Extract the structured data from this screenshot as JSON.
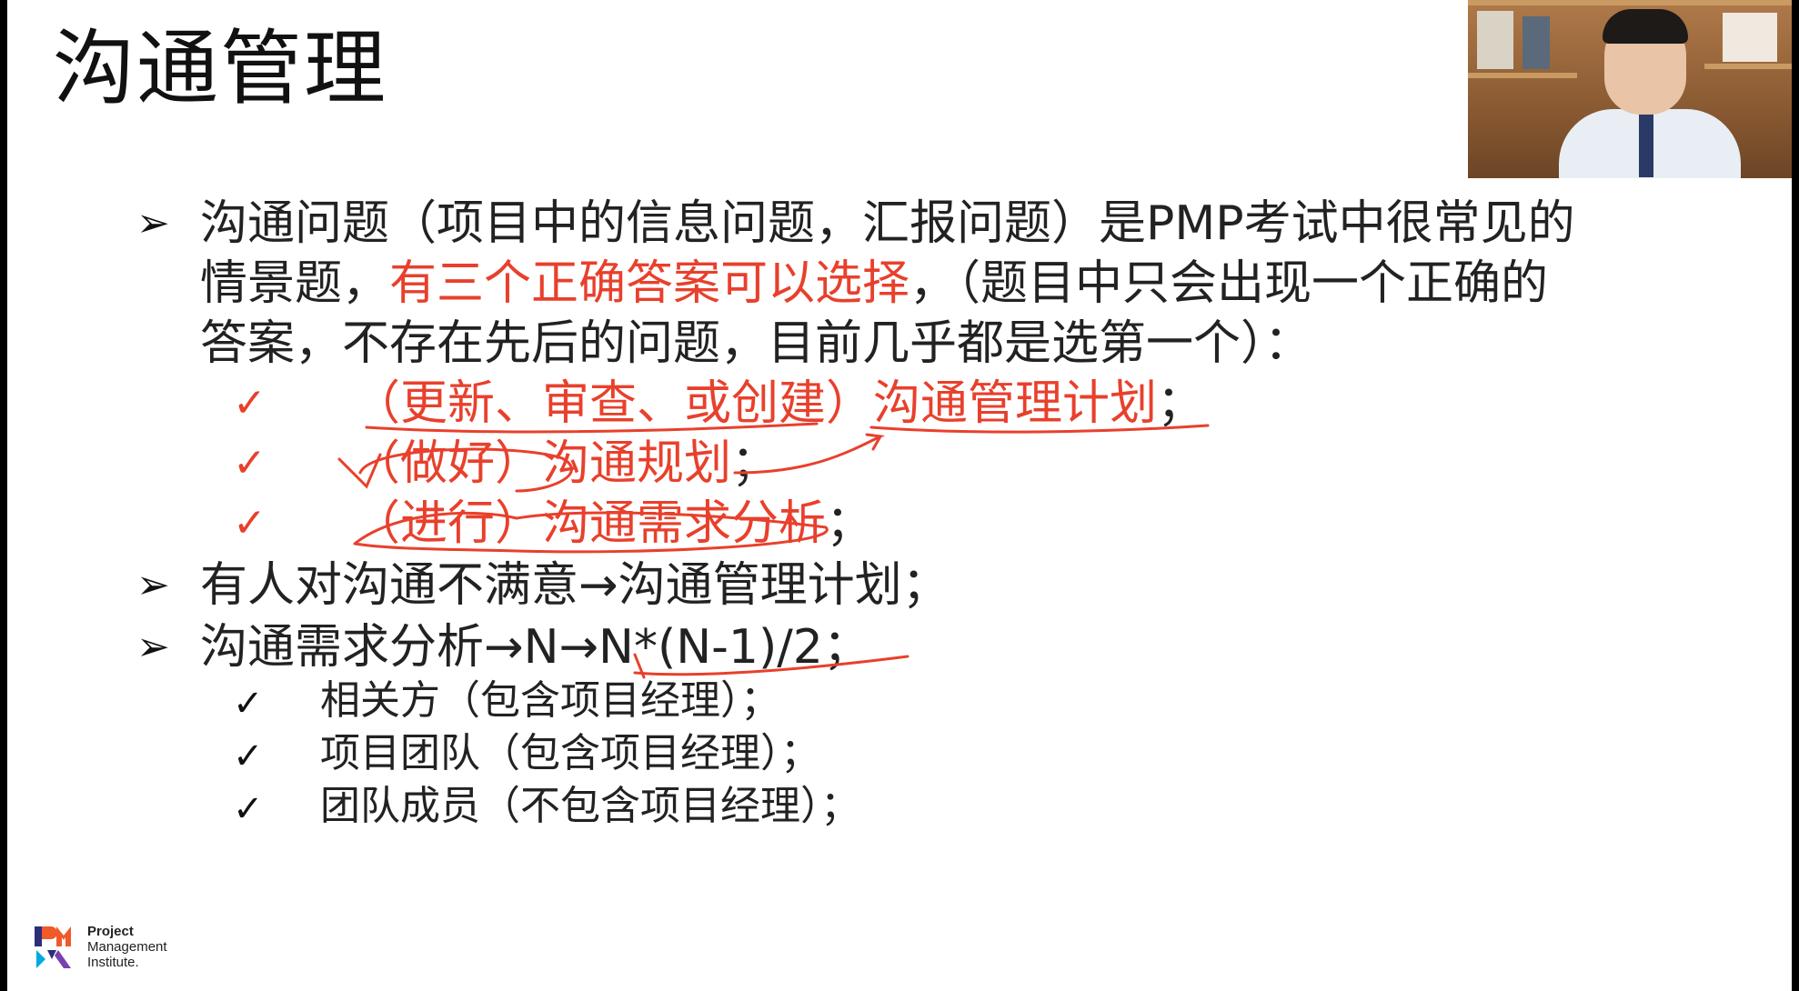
{
  "slide": {
    "title": "沟通管理",
    "bullets": [
      {
        "line1": "沟通问题（项目中的信息问题，汇报问题）是PMP考试中很常见的",
        "line2_a": "情景题，",
        "line2_red": "有三个正确答案可以选择",
        "line2_b": "，（题目中只会出现一个正确的",
        "line3": "答案，不存在先后的问题，目前几乎都是选第一个）："
      }
    ],
    "red_items": [
      {
        "check": "✓",
        "red": "（更新、审查、或创建）沟通管理计划",
        "tail": "；"
      },
      {
        "check": "✓",
        "red": "（做好）沟通规划",
        "tail": "；"
      },
      {
        "check": "✓",
        "red": "（进行）沟通需求分析",
        "tail": "；"
      }
    ],
    "bullet2": "有人对沟通不满意→沟通管理计划；",
    "bullet3": "沟通需求分析→N→N*(N-1)/2；",
    "sub_items": [
      {
        "check": "✓",
        "text": "相关方（包含项目经理）；"
      },
      {
        "check": "✓",
        "text": "项目团队（包含项目经理）；"
      },
      {
        "check": "✓",
        "text": "团队成员（不包含项目经理）；"
      }
    ],
    "bullet_glyph": "➢"
  },
  "logo": {
    "line1": "Project",
    "line2": "Management",
    "line3": "Institute."
  },
  "colors": {
    "accent_red": "#e8402c",
    "text": "#222222"
  }
}
